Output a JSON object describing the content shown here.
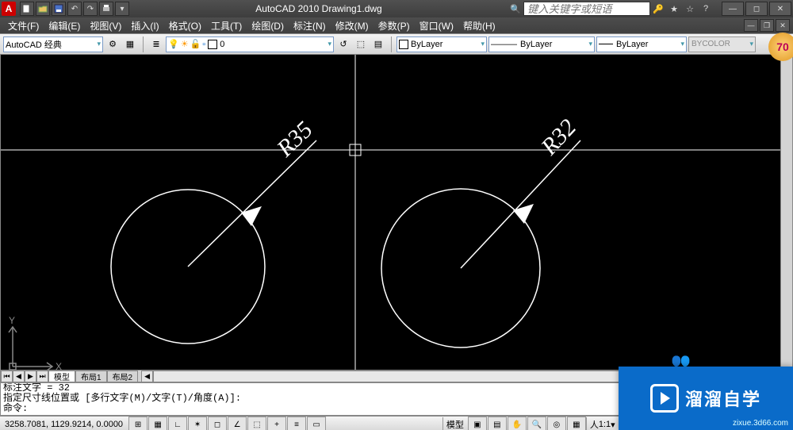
{
  "title": "AutoCAD 2010  Drawing1.dwg",
  "search_placeholder": "键入关键字或短语",
  "menus": [
    "文件(F)",
    "编辑(E)",
    "视图(V)",
    "插入(I)",
    "格式(O)",
    "工具(T)",
    "绘图(D)",
    "标注(N)",
    "修改(M)",
    "参数(P)",
    "窗口(W)",
    "帮助(H)"
  ],
  "workspace": "AutoCAD 经典",
  "layer_current": "0",
  "props": {
    "color": "ByLayer",
    "linetype": "ByLayer",
    "lineweight": "ByLayer",
    "bycolor": "BYCOLOR"
  },
  "tabs": [
    "模型",
    "布局1",
    "布局2"
  ],
  "dims": {
    "left": "R35",
    "right": "R32"
  },
  "cmdlog": [
    "标注文字 = 32",
    "指定尺寸线位置或 [多行文字(M)/文字(T)/角度(A)]:",
    "命令:"
  ],
  "coords": "3258.7081, 1129.9214, 0.0000",
  "status_ws": "AutoCAD 经典",
  "status_model": "模型",
  "status_scale": "1:1",
  "watermark": {
    "brand": "溜溜自学",
    "site": "zixue.3d66.com",
    "badge": "70"
  }
}
